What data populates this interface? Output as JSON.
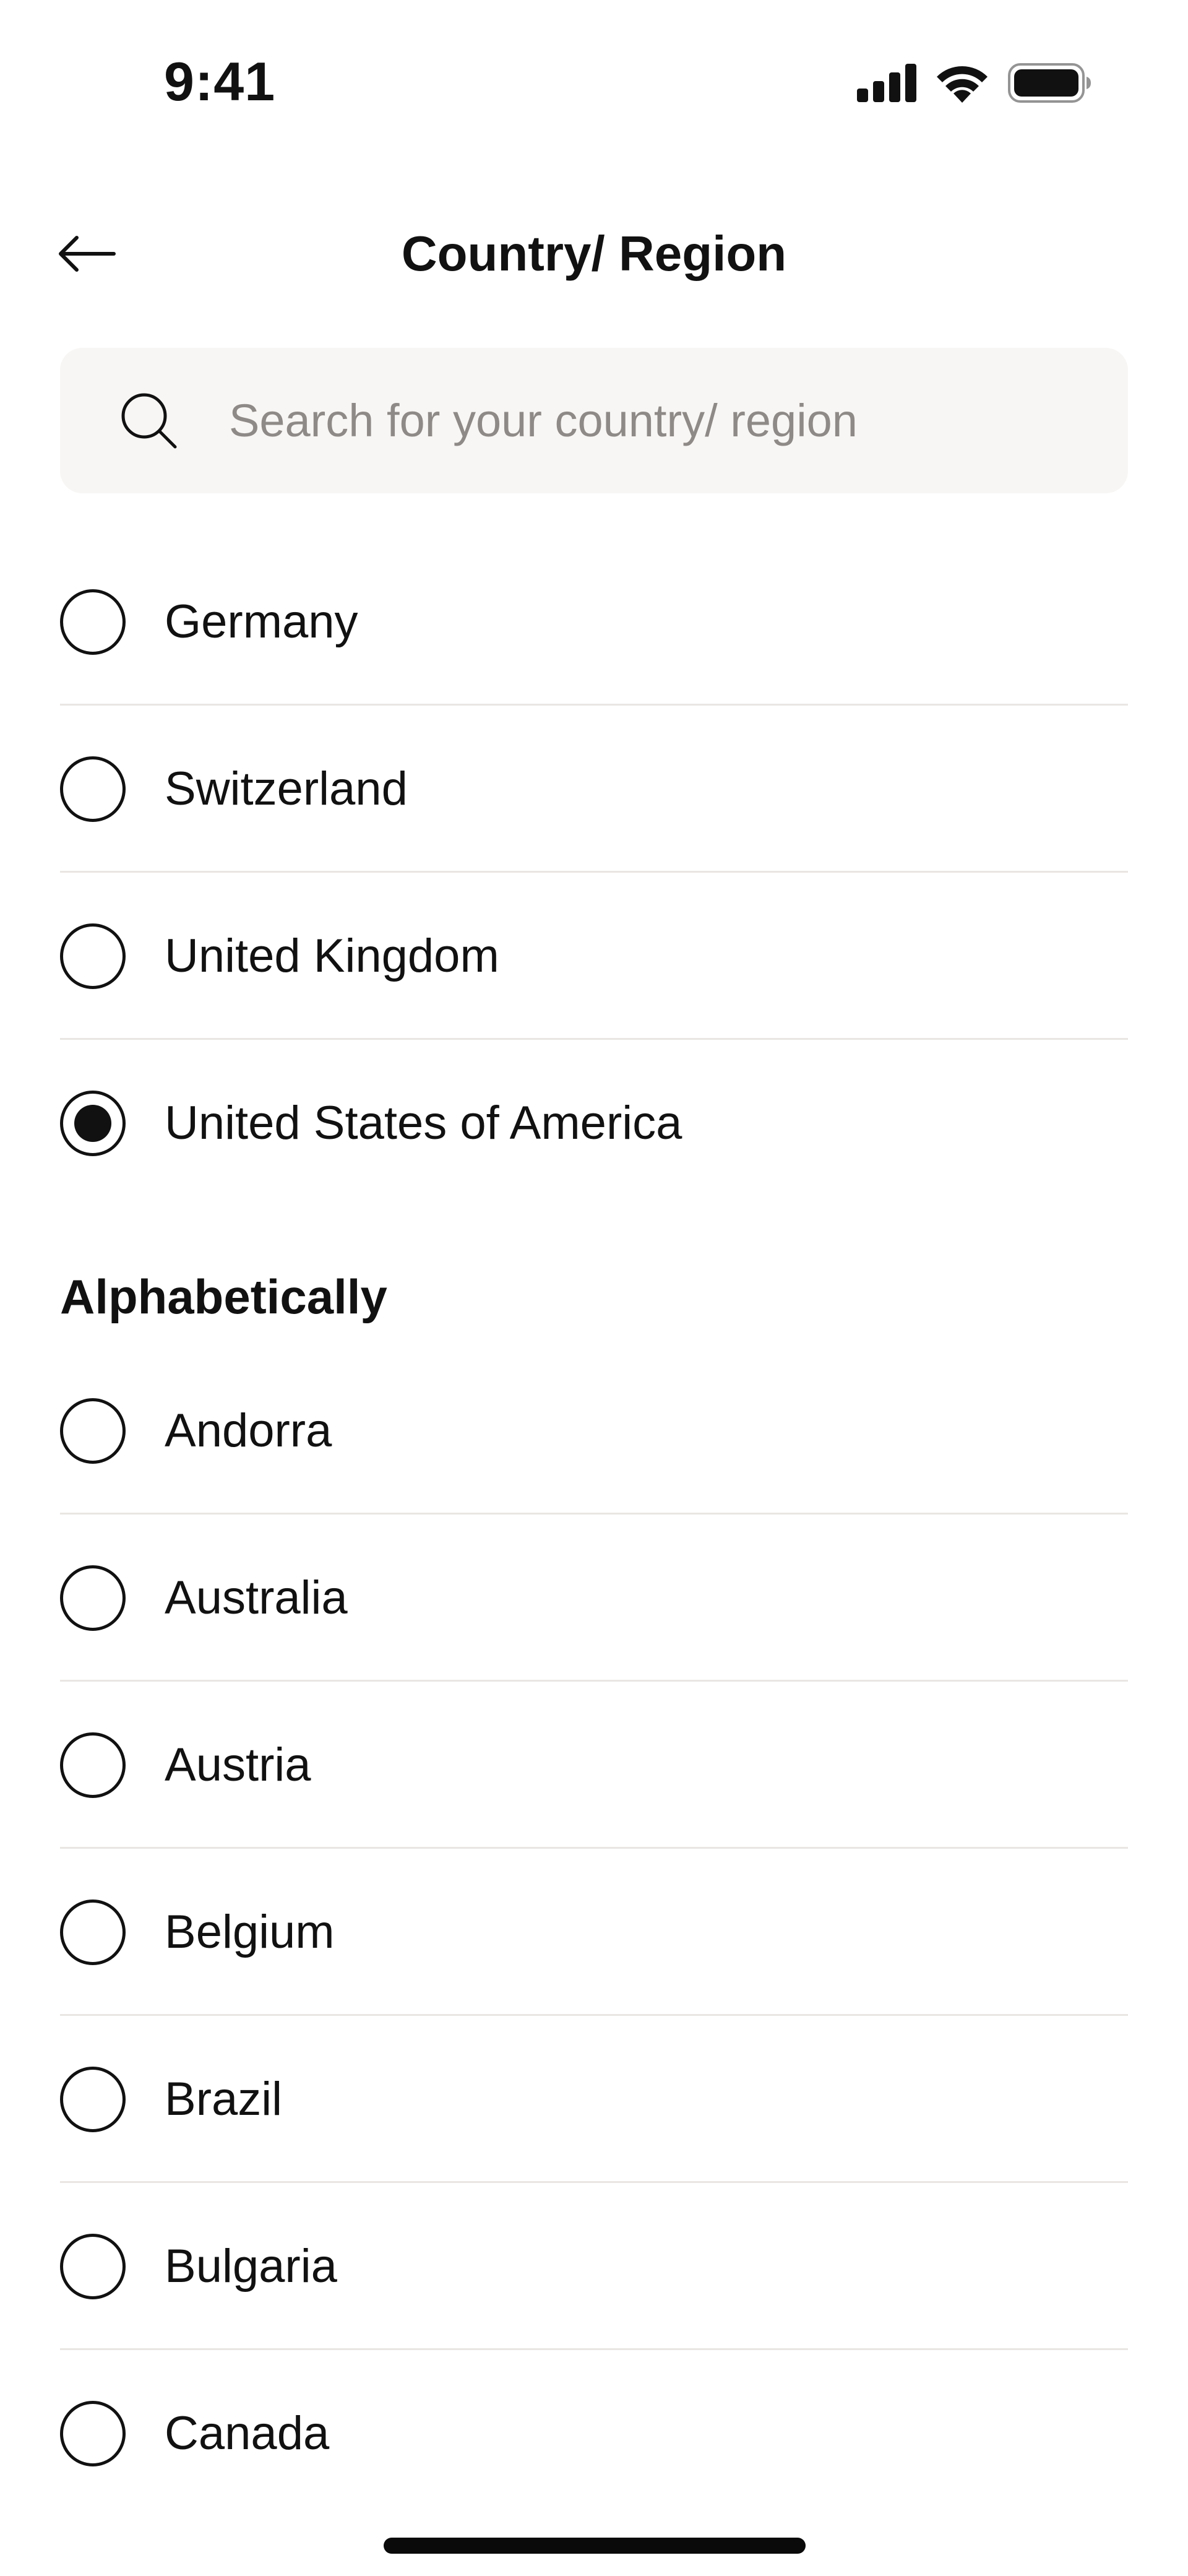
{
  "status_bar": {
    "time": "9:41",
    "icons": [
      "cellular-signal-icon",
      "wifi-icon",
      "battery-icon"
    ]
  },
  "nav": {
    "back_icon": "arrow-left-icon",
    "title": "Country/ Region"
  },
  "search": {
    "icon": "search-icon",
    "placeholder": "Search for your country/ region"
  },
  "suggested": [
    {
      "label": "Germany",
      "selected": false
    },
    {
      "label": "Switzerland",
      "selected": false
    },
    {
      "label": "United Kingdom",
      "selected": false
    },
    {
      "label": "United States of America",
      "selected": true
    }
  ],
  "alphabetical": {
    "heading": "Alphabetically",
    "items": [
      {
        "label": "Andorra",
        "selected": false
      },
      {
        "label": "Australia",
        "selected": false
      },
      {
        "label": "Austria",
        "selected": false
      },
      {
        "label": "Belgium",
        "selected": false
      },
      {
        "label": "Brazil",
        "selected": false
      },
      {
        "label": "Bulgaria",
        "selected": false
      },
      {
        "label": "Canada",
        "selected": false
      }
    ]
  },
  "colors": {
    "search_background": "#f8f6f4",
    "placeholder_text": "#8e8a87",
    "divider": "#e9e6e3",
    "text": "#111111"
  }
}
